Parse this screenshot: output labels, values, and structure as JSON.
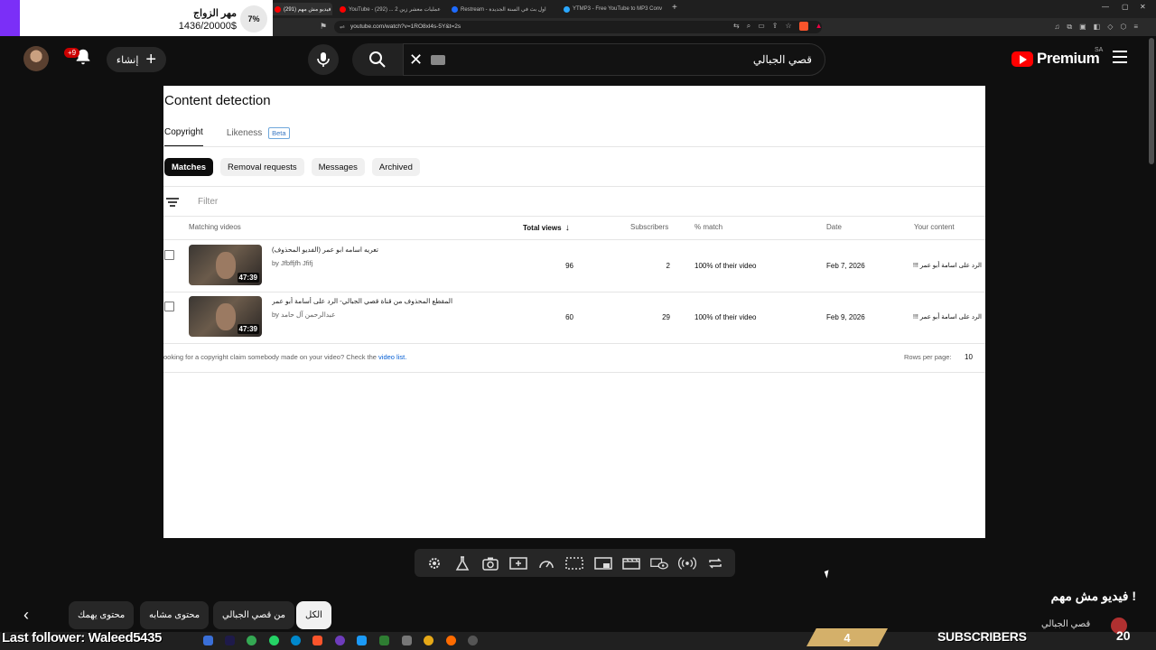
{
  "browser": {
    "tabs": [
      {
        "label": "(291) فيديو مش مهم",
        "active": true,
        "color": "#ff0000"
      },
      {
        "label": "YouTube - عمليات معشر زين 2 ... (292)",
        "active": false,
        "color": "#ff0000"
      },
      {
        "label": "Restream - اول بث في السنة الجديدة",
        "active": false,
        "color": "#1e6bff"
      },
      {
        "label": "YTMP3 - Free YouTube to MP3 Conv",
        "active": false,
        "color": "#2aa7ff"
      }
    ],
    "new_tab": "+",
    "url": "youtube.com/watch?v=1RO8xl4s-5Y&t=2s"
  },
  "donation": {
    "title": "مهر الزواج",
    "amount": "1436/20000$",
    "percent": "7%"
  },
  "header": {
    "notifications_badge": "+9",
    "create_label": "إنشاء",
    "search_query": "قصي الجبالي",
    "logo_text": "Premium",
    "country": "SA"
  },
  "panel": {
    "title": "Content detection",
    "tabs": [
      {
        "label": "Copyright",
        "active": true
      },
      {
        "label": "Likeness",
        "active": false,
        "badge": "Beta"
      }
    ],
    "chips": [
      {
        "label": "Matches",
        "active": true
      },
      {
        "label": "Removal requests",
        "active": false
      },
      {
        "label": "Messages",
        "active": false
      },
      {
        "label": "Archived",
        "active": false
      }
    ],
    "filter_placeholder": "Filter",
    "columns": {
      "matching": "Matching videos",
      "views": "Total views",
      "views_sort": "↓",
      "subscribers": "Subscribers",
      "match": "% match",
      "date": "Date",
      "your_content": "Your content"
    },
    "rows": [
      {
        "title": "تعريه اسامه ابو عمر (الفديو المحذوف)",
        "by": "by Jfbffjfh Jfifj",
        "duration": "47:39",
        "views": "96",
        "subscribers": "2",
        "match": "100% of their video",
        "date": "Feb 7, 2026",
        "your_content": "!!! الرد على اسامة أبو عمر"
      },
      {
        "title": "المقطع المحذوف من قناة قصي الجبالي- الرد على أسامة أبو عمر",
        "by": "by عبدالرحمن آل حامد",
        "duration": "47:39",
        "views": "60",
        "subscribers": "29",
        "match": "100% of their video",
        "date": "Feb 9, 2026",
        "your_content": "!!! الرد على اسامة أبو عمر"
      }
    ],
    "footnote_text": "ooking for a copyright claim somebody made on your video? Check the ",
    "footnote_link": "video list.",
    "rows_per_page_label": "Rows per page:",
    "rows_per_page_value": "10"
  },
  "filter_chips": [
    {
      "label": "الكل",
      "active": true
    },
    {
      "label": "من قصي الجبالي",
      "active": false
    },
    {
      "label": "محتوى مشابه",
      "active": false
    },
    {
      "label": "محتوى يهمك",
      "active": false
    }
  ],
  "video_title": "فيديو مش مهم !",
  "stream": {
    "last_follower": "Last follower: Waleed5435",
    "gold_badge": "4",
    "subscribers_label": "SUBSCRIBERS",
    "channel_name": "قصي الجبالي",
    "subscriber_count": "20"
  },
  "colors": {
    "accent_red": "#ff0000",
    "link_blue": "#065fd4",
    "donation_purple": "#7b2ff7"
  }
}
